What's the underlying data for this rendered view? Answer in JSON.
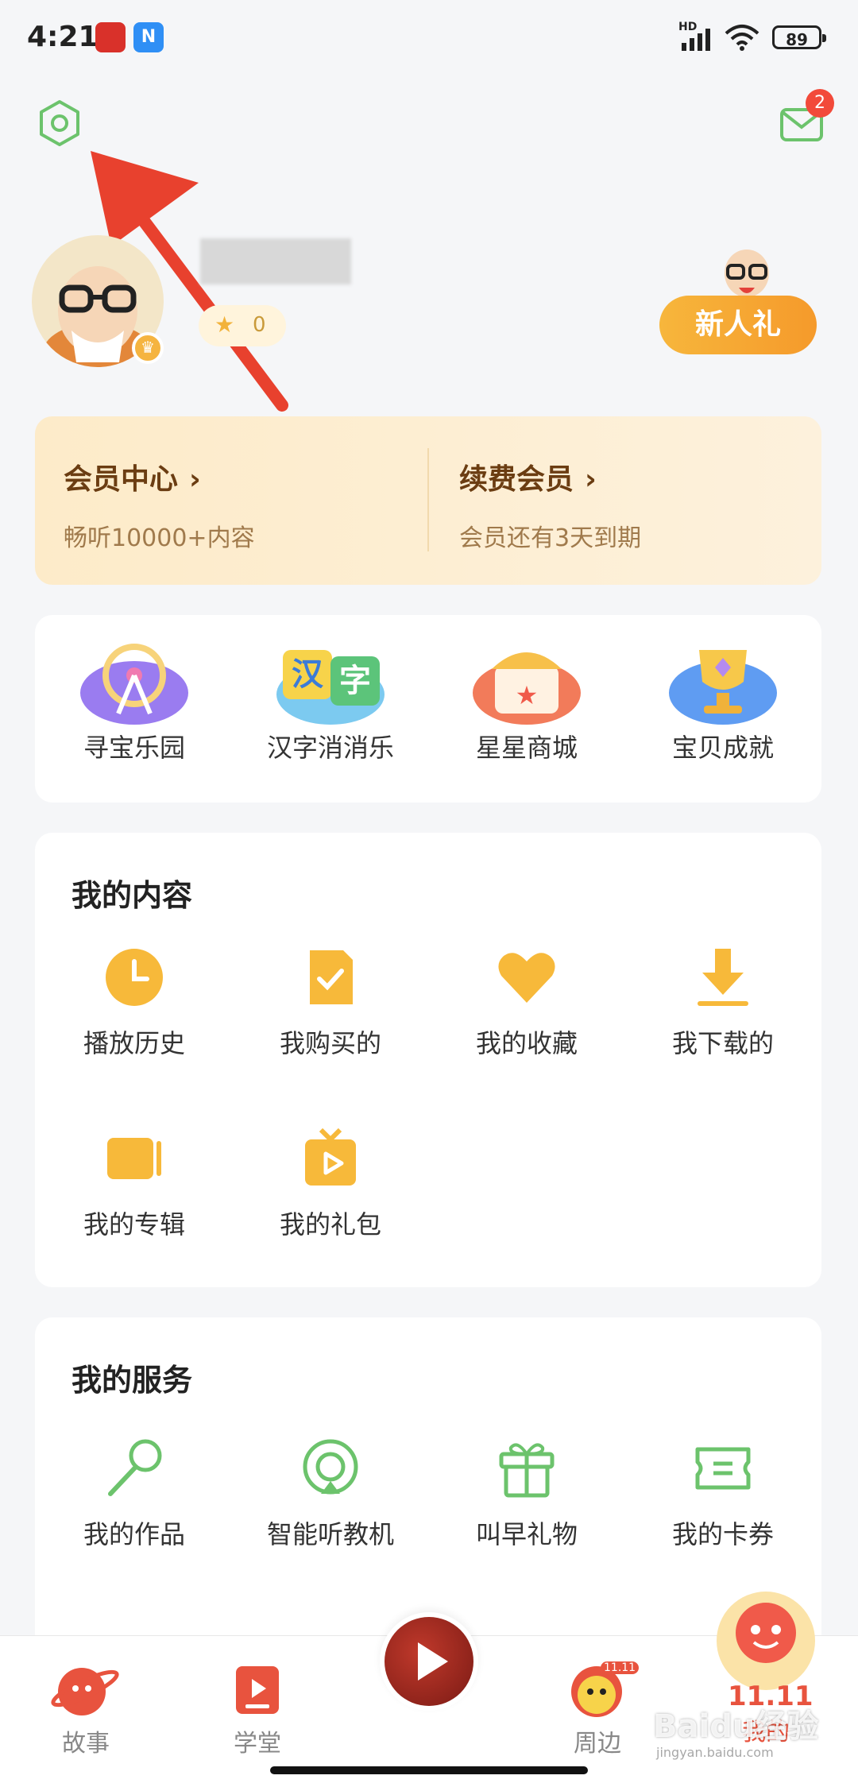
{
  "status_bar": {
    "time": "4:21",
    "app_badges": [
      "",
      "N"
    ],
    "network": "HD",
    "battery": "89"
  },
  "header": {
    "settings_icon": "gear-icon",
    "mail_badge": "2"
  },
  "profile": {
    "star_count": "0",
    "new_user_gift": "新人礼"
  },
  "vip": {
    "center_title": "会员中心",
    "center_desc": "畅听10000+内容",
    "renew_title": "续费会员",
    "renew_desc": "会员还有3天到期"
  },
  "features": [
    {
      "label": "寻宝乐园",
      "icon": "ferris-wheel-icon"
    },
    {
      "label": "汉字消消乐",
      "icon": "hanzi-icon",
      "glyph": "汉字"
    },
    {
      "label": "星星商城",
      "icon": "shop-icon"
    },
    {
      "label": "宝贝成就",
      "icon": "trophy-icon"
    }
  ],
  "my_content": {
    "title": "我的内容",
    "items": [
      {
        "label": "播放历史",
        "icon": "clock-icon"
      },
      {
        "label": "我购买的",
        "icon": "purchased-icon"
      },
      {
        "label": "我的收藏",
        "icon": "heart-icon"
      },
      {
        "label": "我下载的",
        "icon": "download-icon"
      },
      {
        "label": "我的专辑",
        "icon": "album-icon"
      },
      {
        "label": "我的礼包",
        "icon": "gift-package-icon"
      }
    ]
  },
  "my_services": {
    "title": "我的服务",
    "items": [
      {
        "label": "我的作品",
        "icon": "microphone-icon"
      },
      {
        "label": "智能听教机",
        "icon": "device-icon"
      },
      {
        "label": "叫早礼物",
        "icon": "gift-icon"
      },
      {
        "label": "我的卡券",
        "icon": "coupon-icon"
      }
    ]
  },
  "tabbar": {
    "tabs": [
      {
        "label": "故事",
        "icon": "story-planet-icon"
      },
      {
        "label": "学堂",
        "icon": "classroom-icon"
      },
      {
        "label": "",
        "icon": "play-icon"
      },
      {
        "label": "周边",
        "icon": "mascot-icon",
        "badge": "11.11"
      },
      {
        "label": "我的",
        "icon": "octopus-icon",
        "badge": "11.11"
      }
    ]
  },
  "watermark": "Baidu经验",
  "watermark_sub": "jingyan.baidu.com"
}
